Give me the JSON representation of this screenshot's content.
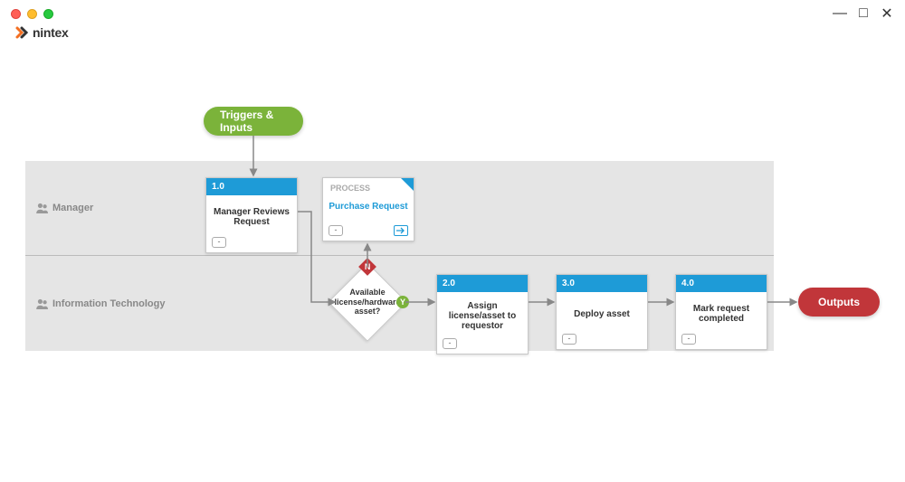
{
  "brand": {
    "name": "nintex"
  },
  "window": {
    "minimize": "—",
    "maximize": "□",
    "close": "✕"
  },
  "lanes": {
    "manager": "Manager",
    "it": "Information Technology"
  },
  "triggers": {
    "label": "Triggers & Inputs"
  },
  "outputs": {
    "label": "Outputs"
  },
  "tasks": {
    "t1": {
      "id": "1.0",
      "title": "Manager Reviews Request"
    },
    "t2": {
      "id": "2.0",
      "title": "Assign license/asset to requestor"
    },
    "t3": {
      "id": "3.0",
      "title": "Deploy asset"
    },
    "t4": {
      "id": "4.0",
      "title": "Mark request completed"
    }
  },
  "process": {
    "label": "PROCESS",
    "title": "Purchase Request"
  },
  "decision": {
    "text": "Available license/hardware asset?",
    "no": "N",
    "yes": "Y"
  },
  "footer": {
    "minus": "-"
  }
}
